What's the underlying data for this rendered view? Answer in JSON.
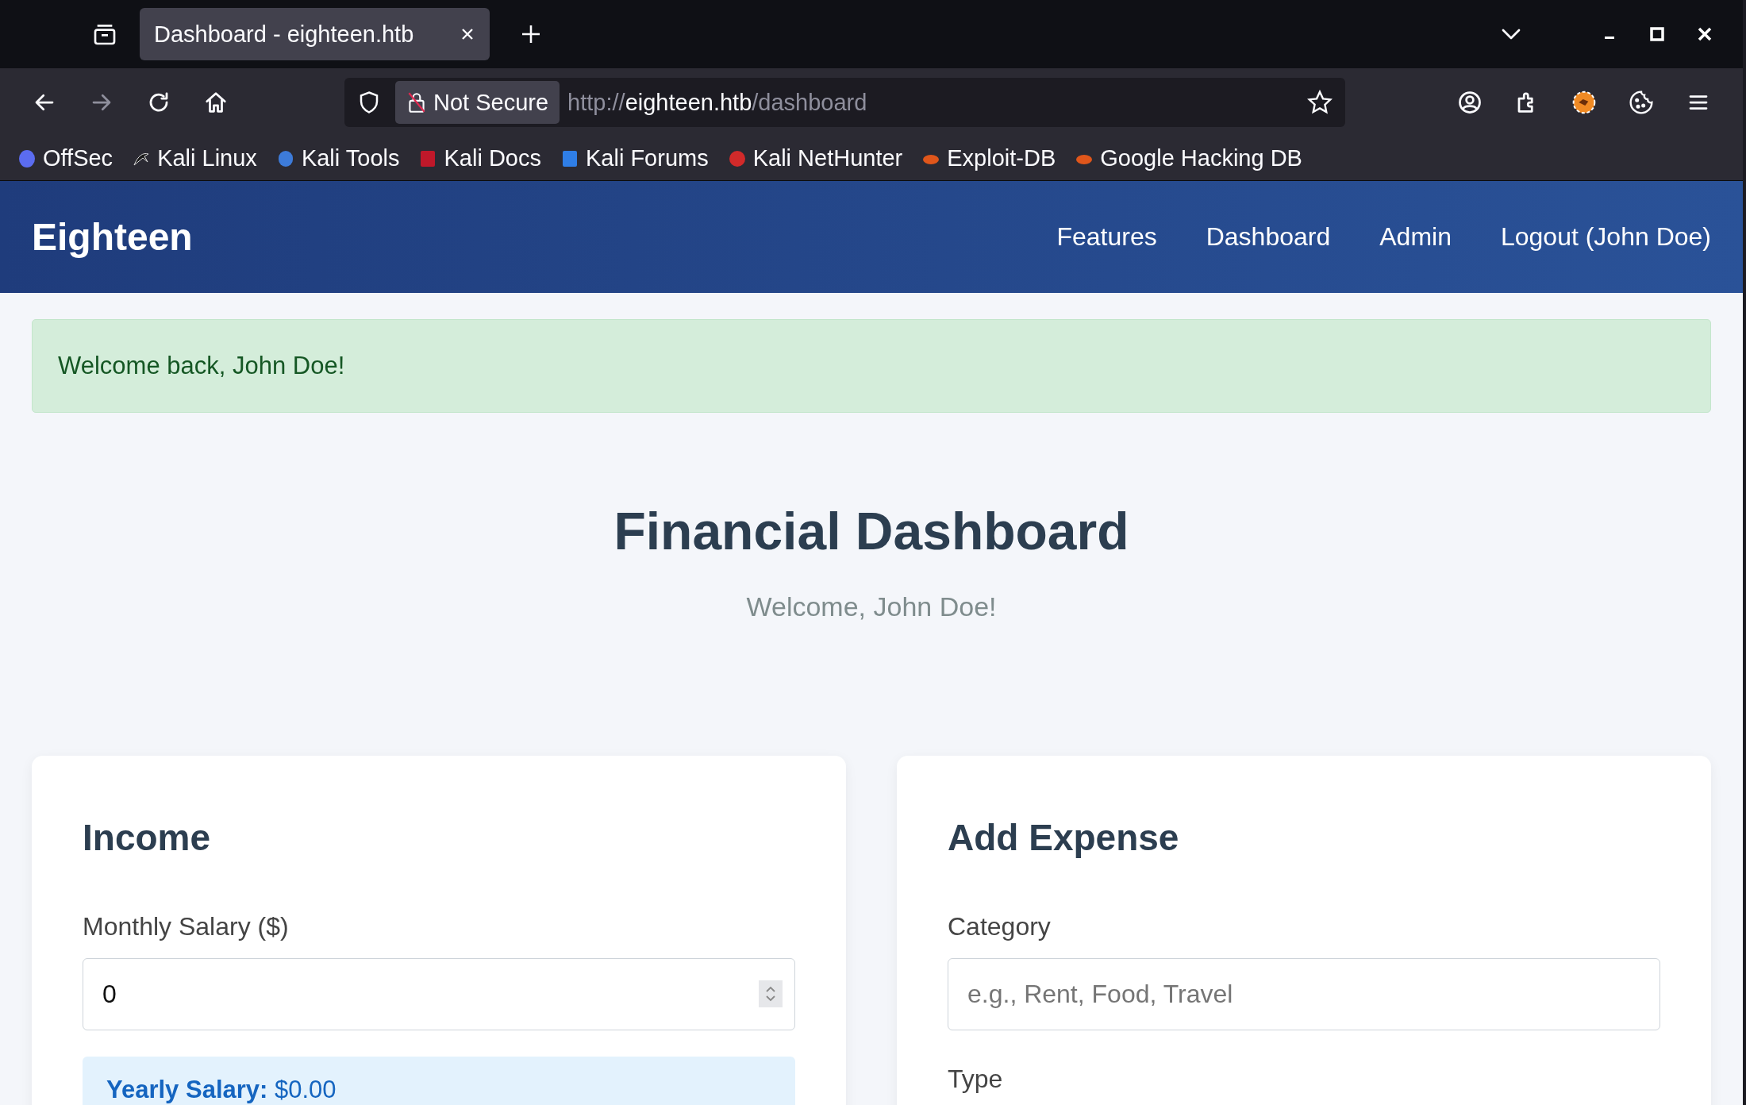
{
  "browser": {
    "tabs": [
      {
        "title": "Dashboard - eighteen.htb",
        "selected": true
      }
    ],
    "address": {
      "security": "Not Secure",
      "scheme": "http://",
      "host": "eighteen.htb",
      "path": "/dashboard"
    },
    "bookmarks": [
      {
        "label": "OffSec",
        "color": "#5b6cf0"
      },
      {
        "label": "Kali Linux",
        "color": "#1a1a1a"
      },
      {
        "label": "Kali Tools",
        "color": "#3d7bd9"
      },
      {
        "label": "Kali Docs",
        "color": "#c0182a"
      },
      {
        "label": "Kali Forums",
        "color": "#2f7ee6"
      },
      {
        "label": "Kali NetHunter",
        "color": "#d22a2a"
      },
      {
        "label": "Exploit-DB",
        "color": "#e0561b"
      },
      {
        "label": "Google Hacking DB",
        "color": "#e0561b"
      }
    ]
  },
  "site": {
    "brand": "Eighteen",
    "nav": [
      {
        "label": "Features"
      },
      {
        "label": "Dashboard"
      },
      {
        "label": "Admin"
      },
      {
        "label": "Logout (John Doe)"
      }
    ],
    "alert": "Welcome back, John Doe!",
    "heading": "Financial Dashboard",
    "subtitle": "Welcome, John Doe!",
    "cards": [
      {
        "title": "Income",
        "fields": [
          {
            "kind": "number",
            "label": "Monthly Salary ($)",
            "value": "0"
          }
        ],
        "summary": {
          "label": "Yearly Salary:",
          "value": "$0.00"
        }
      },
      {
        "title": "Add Expense",
        "fields": [
          {
            "kind": "text",
            "label": "Category",
            "placeholder": "e.g., Rent, Food, Travel"
          },
          {
            "kind": "label",
            "label": "Type"
          }
        ]
      }
    ]
  }
}
